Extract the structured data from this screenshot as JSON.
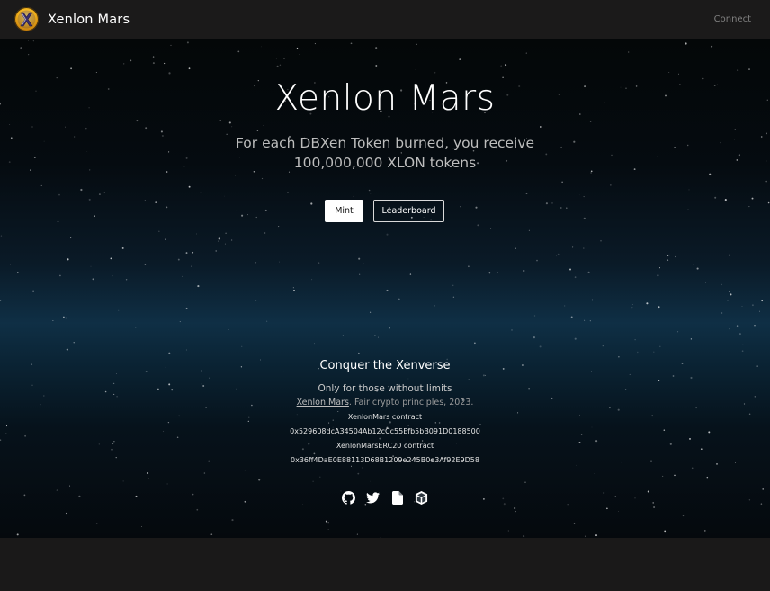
{
  "navbar": {
    "brand": "Xenlon Mars",
    "connect_label": "Connect",
    "logo_icon": "xenlon-x-logo"
  },
  "hero": {
    "title": "Xenlon Mars",
    "subtitle_line1": "For each DBXen Token burned, you receive",
    "subtitle_line2": "100,000,000 XLON tokens",
    "mint_label": "Mint",
    "leaderboard_label": "Leaderboard"
  },
  "footer": {
    "title": "Conquer the Xenverse",
    "tagline": "Only for those without limits",
    "credit_link": "Xenlon Mars",
    "credit_text": ". Fair crypto principles, 2023.",
    "contract1_label": "XenlonMars contract",
    "contract1_address": "0x529608dcA34504Ab12cCc55Efb5bB091D0188500",
    "contract2_label": "XenlonMarsERC20 contract",
    "contract2_address": "0x36ff4DaE0E88113D68B1209e245B0e3Af92E9D58",
    "icons": [
      "github-icon",
      "twitter-icon",
      "document-icon",
      "cube-icon"
    ]
  },
  "colors": {
    "navbar_bg": "#1b1a1a",
    "hero_glow": "#0f2f45",
    "connect_text": "#7f7f7f"
  }
}
